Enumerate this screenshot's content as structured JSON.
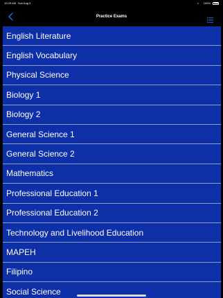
{
  "status_bar": {
    "time": "10:29 AM",
    "date": "Sun Aug 9",
    "battery": "100%"
  },
  "nav": {
    "title": "Practice Exams",
    "back_icon": "chevron-left-icon",
    "list_icon": "list-icon"
  },
  "exams": [
    "English Literature",
    "English Vocabulary",
    "Physical Science",
    "Biology 1",
    "Biology 2",
    "General Science 1",
    "General Science 2",
    "Mathematics",
    "Professional Education 1",
    "Professional Education 2",
    "Technology and Livelihood Education",
    "MAPEH",
    "Filipino",
    "Social Science"
  ],
  "colors": {
    "background": "#000000",
    "list_background": "#0d2fa8",
    "separator": "#8f9fc9",
    "accent": "#1f72ff"
  }
}
